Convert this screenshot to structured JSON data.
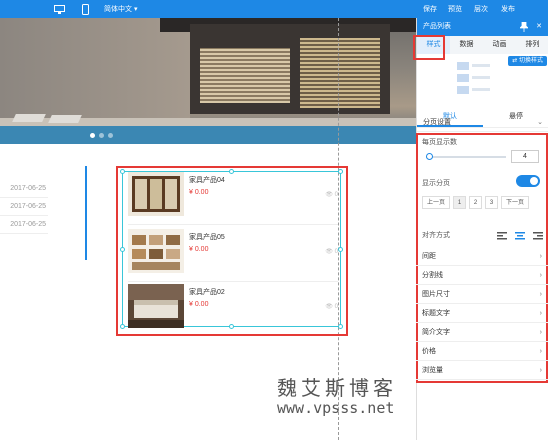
{
  "topbar": {
    "language": "简体中文",
    "actions": [
      "保存",
      "预览",
      "层次",
      "发布"
    ]
  },
  "dates": [
    "2017-06-25",
    "2017-06-25",
    "2017-06-25"
  ],
  "products": [
    {
      "name": "家具产品04",
      "price": "¥ 0.00",
      "views": "0"
    },
    {
      "name": "家具产品05",
      "price": "¥ 0.00",
      "views": "0"
    },
    {
      "name": "家具产品02",
      "price": "¥ 0.00",
      "views": "0"
    }
  ],
  "panel": {
    "title": "产品列表",
    "tabs": [
      "样式",
      "数据",
      "动画",
      "排列"
    ],
    "switch_style": "切换样式",
    "subtabs": [
      "默认",
      "悬停"
    ],
    "section_label": "分页设置",
    "per_page_label": "每页显示数",
    "per_page_value": "4",
    "show_paging_label": "显示分页",
    "pager": {
      "prev": "上一页",
      "pages": [
        "1",
        "2",
        "3"
      ],
      "next": "下一页"
    },
    "align_label": "对齐方式",
    "items": [
      "间距",
      "分割线",
      "图片尺寸",
      "标题文字",
      "简介文字",
      "价格",
      "浏览量"
    ]
  },
  "watermark": {
    "cn": "魏艾斯博客",
    "url": "www.vpsss.net"
  },
  "colors": {
    "accent": "#1e88e5",
    "highlight": "#e53935",
    "price": "#e53935"
  }
}
